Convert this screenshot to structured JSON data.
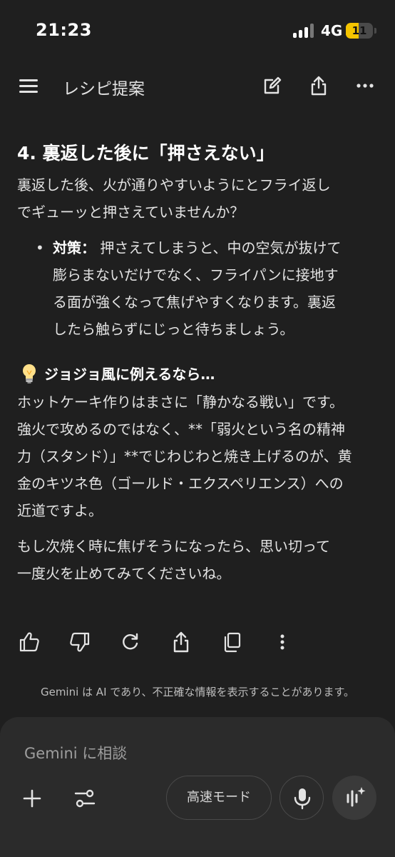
{
  "status_bar": {
    "time": "21:23",
    "network": "4G",
    "battery_level": "11",
    "battery_color": "#f5c400"
  },
  "header": {
    "title": "レシピ提案",
    "icons": [
      "menu-icon",
      "edit-icon",
      "share-icon",
      "more-icon"
    ]
  },
  "response": {
    "heading": "4. 裏返した後に「押さえない」",
    "intro_lines": [
      "裏返した後、火が通りやすいようにとフライ返し",
      "でギューッと押さえていませんか？"
    ],
    "bullet": {
      "label": "対策：",
      "text_line1": "押さえてしまうと、中の空気が抜けて",
      "text_lines": [
        "膨らまないだけでなく、フライパンに接地す",
        "る面が強くなって焦げやすくなります。裏返",
        "したら触らずにじっと待ちましょう。"
      ]
    },
    "tip_heading": "ジョジョ風に例えるなら…",
    "tip_lines": [
      "ホットケーキ作りはまさに「静かなる戦い」です。",
      "強火で攻めるのではなく、**「弱火という名の精神",
      "力（スタンド）」**でじわじわと焼き上げるのが、黄",
      "金のキツネ色（ゴールド・エクスペリエンス）への",
      "近道ですよ。"
    ],
    "closing_lines": [
      "もし次焼く時に焦げそうになったら、思い切って",
      "一度火を止めてみてくださいね。"
    ]
  },
  "actions": [
    "thumbs-up-icon",
    "thumbs-down-icon",
    "regenerate-icon",
    "share-icon",
    "copy-icon",
    "more-icon"
  ],
  "disclaimer": "Gemini は AI であり、不正確な情報を表示することがあります。",
  "composer": {
    "placeholder": "Gemini に相談",
    "mode_label": "高速モード"
  },
  "colors": {
    "background": "#1f1f1f",
    "composer": "#2b2b2b",
    "text": "#e3e3e3"
  }
}
